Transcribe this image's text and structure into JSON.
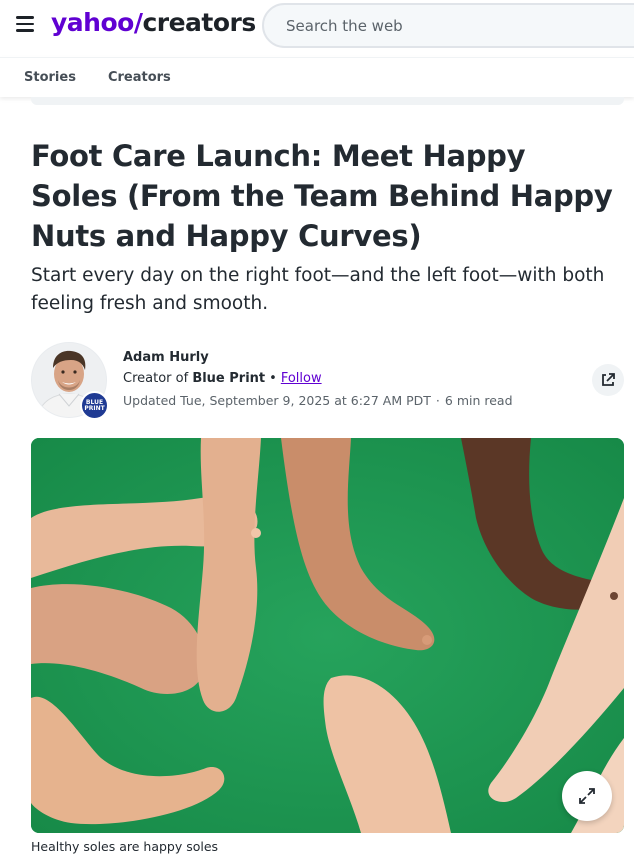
{
  "header": {
    "logo_yahoo": "yahoo/",
    "logo_creators": "creators",
    "search_placeholder": "Search the web",
    "menu_icon": "hamburger-menu-icon",
    "brand_color": "#6001d2"
  },
  "subnav": {
    "items": [
      {
        "label": "Stories"
      },
      {
        "label": "Creators"
      }
    ]
  },
  "article": {
    "headline": "Foot Care Launch: Meet Happy Soles (From the Team Behind Happy Nuts and Happy Curves)",
    "subheadline": "Start every day on the right foot—and the left foot—with both feeling fresh and smooth.",
    "author": {
      "name": "Adam Hurly",
      "creator_prefix": "Creator of",
      "creator_of": "Blue Print",
      "follow_label": "Follow",
      "badge_text_line1": "BLUE",
      "badge_text_line2": "PRINT"
    },
    "updated": "Updated Tue, September 9, 2025 at 6:27 AM PDT",
    "read_time": "6 min read",
    "share_icon": "share-external-icon",
    "hero_caption": "Healthy soles are happy soles",
    "expand_icon": "expand-arrows-icon"
  }
}
